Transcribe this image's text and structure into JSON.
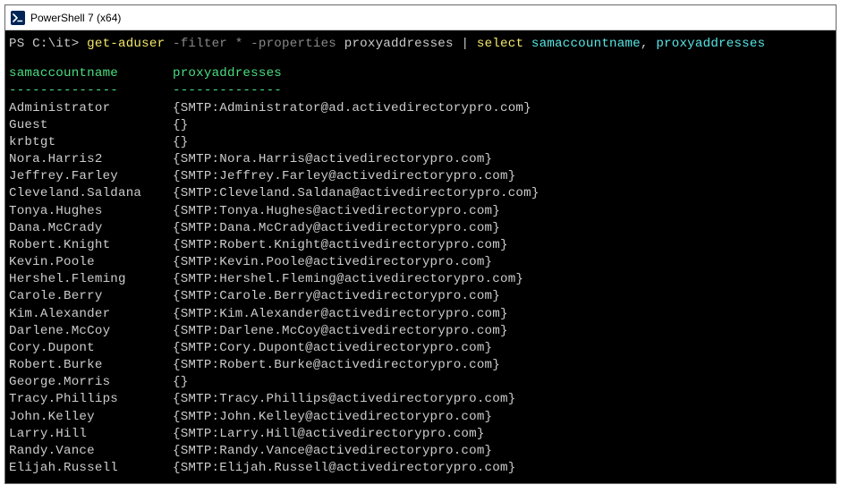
{
  "window": {
    "title": "PowerShell 7 (x64)"
  },
  "prompt": {
    "path": "PS C:\\it> ",
    "cmd1": "get-aduser ",
    "arg_filter_flag": "-filter ",
    "arg_filter_val": "* ",
    "arg_prop_flag": "-properties ",
    "arg_prop_val": "proxyaddresses ",
    "pipe": "| ",
    "cmd2": "select ",
    "cols": "samaccountname",
    "cols_sep": ", ",
    "cols2": "proxyaddresses"
  },
  "headers": {
    "col1": "samaccountname",
    "col2": "proxyaddresses"
  },
  "underline": {
    "col1": "--------------",
    "col2": "--------------"
  },
  "rows": [
    {
      "sam": "Administrator",
      "proxy": "{SMTP:Administrator@ad.activedirectorypro.com}"
    },
    {
      "sam": "Guest",
      "proxy": "{}"
    },
    {
      "sam": "krbtgt",
      "proxy": "{}"
    },
    {
      "sam": "Nora.Harris2",
      "proxy": "{SMTP:Nora.Harris@activedirectorypro.com}"
    },
    {
      "sam": "Jeffrey.Farley",
      "proxy": "{SMTP:Jeffrey.Farley@activedirectorypro.com}"
    },
    {
      "sam": "Cleveland.Saldana",
      "proxy": "{SMTP:Cleveland.Saldana@activedirectorypro.com}"
    },
    {
      "sam": "Tonya.Hughes",
      "proxy": "{SMTP:Tonya.Hughes@activedirectorypro.com}"
    },
    {
      "sam": "Dana.McCrady",
      "proxy": "{SMTP:Dana.McCrady@activedirectorypro.com}"
    },
    {
      "sam": "Robert.Knight",
      "proxy": "{SMTP:Robert.Knight@activedirectorypro.com}"
    },
    {
      "sam": "Kevin.Poole",
      "proxy": "{SMTP:Kevin.Poole@activedirectorypro.com}"
    },
    {
      "sam": "Hershel.Fleming",
      "proxy": "{SMTP:Hershel.Fleming@activedirectorypro.com}"
    },
    {
      "sam": "Carole.Berry",
      "proxy": "{SMTP:Carole.Berry@activedirectorypro.com}"
    },
    {
      "sam": "Kim.Alexander",
      "proxy": "{SMTP:Kim.Alexander@activedirectorypro.com}"
    },
    {
      "sam": "Darlene.McCoy",
      "proxy": "{SMTP:Darlene.McCoy@activedirectorypro.com}"
    },
    {
      "sam": "Cory.Dupont",
      "proxy": "{SMTP:Cory.Dupont@activedirectorypro.com}"
    },
    {
      "sam": "Robert.Burke",
      "proxy": "{SMTP:Robert.Burke@activedirectorypro.com}"
    },
    {
      "sam": "George.Morris",
      "proxy": "{}"
    },
    {
      "sam": "Tracy.Phillips",
      "proxy": "{SMTP:Tracy.Phillips@activedirectorypro.com}"
    },
    {
      "sam": "John.Kelley",
      "proxy": "{SMTP:John.Kelley@activedirectorypro.com}"
    },
    {
      "sam": "Larry.Hill",
      "proxy": "{SMTP:Larry.Hill@activedirectorypro.com}"
    },
    {
      "sam": "Randy.Vance",
      "proxy": "{SMTP:Randy.Vance@activedirectorypro.com}"
    },
    {
      "sam": "Elijah.Russell",
      "proxy": "{SMTP:Elijah.Russell@activedirectorypro.com}"
    }
  ]
}
